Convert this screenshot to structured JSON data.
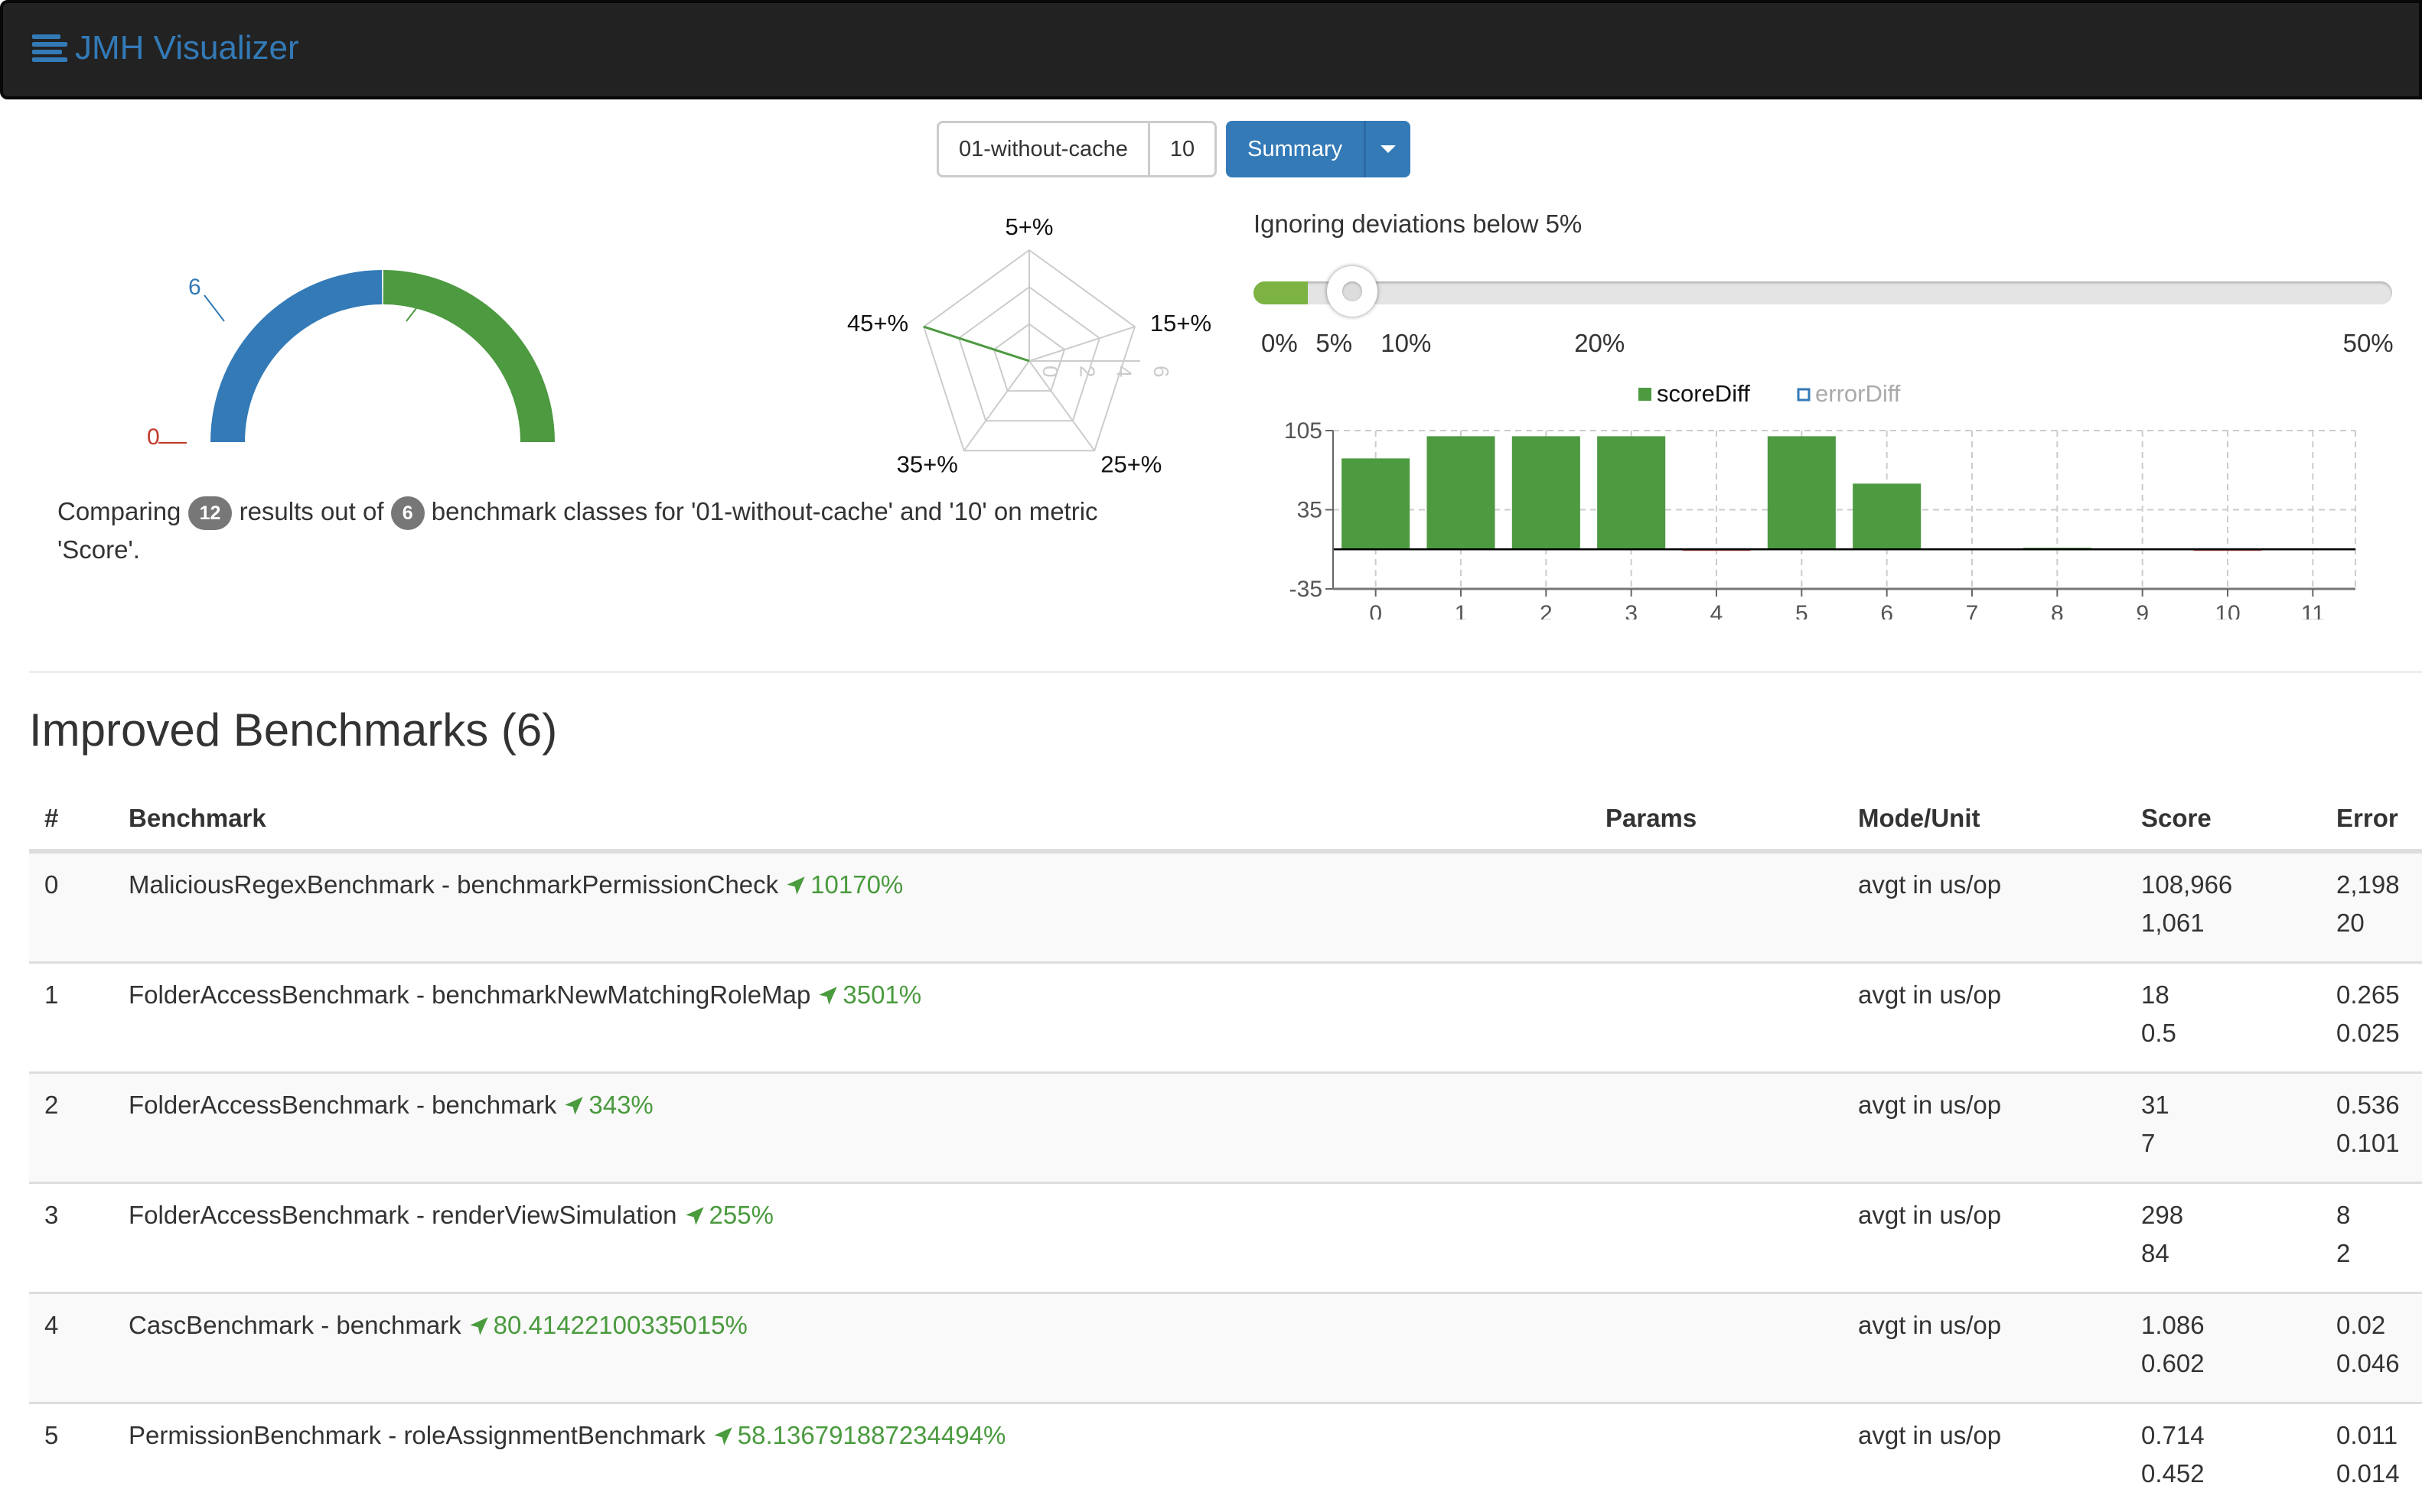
{
  "header": {
    "title": "JMH Visualizer",
    "icon": "list-icon"
  },
  "controls": {
    "run_a": "01-without-cache",
    "run_b": "10",
    "view_button": "Summary",
    "dropdown_icon": "caret-down-icon"
  },
  "gauge": {
    "left_value": "6",
    "right_value": "6",
    "zero_value": "0",
    "colors": {
      "worse": "#337ab7",
      "better": "#4d9a41",
      "zero": "#c0392b"
    }
  },
  "radar": {
    "axes": [
      "5+%",
      "15+%",
      "25+%",
      "35+%",
      "45+%"
    ],
    "values": [
      0,
      0,
      0,
      0,
      6
    ],
    "scale_ticks": [
      "0",
      "2",
      "4",
      "6"
    ],
    "max": 6
  },
  "description": {
    "prefix": "Comparing",
    "results_count": "12",
    "middle": "results out of",
    "classes_count": "6",
    "suffix": "benchmark classes for '01-without-cache' and '10' on metric 'Score'."
  },
  "slider": {
    "label": "Ignoring deviations below 5%",
    "value_percent": 5,
    "max_percent": 50,
    "ticks": [
      {
        "label": "0%",
        "value": 0
      },
      {
        "label": "5%",
        "value": 5
      },
      {
        "label": "10%",
        "value": 10
      },
      {
        "label": "20%",
        "value": 20
      },
      {
        "label": "50%",
        "value": 50
      }
    ]
  },
  "chart_data": {
    "type": "bar",
    "legend": [
      {
        "name": "scoreDiff",
        "color": "#4d9a41",
        "active": true
      },
      {
        "name": "errorDiff",
        "color": "#337ab7",
        "active": false
      }
    ],
    "legend_position": "top-center",
    "categories": [
      "0",
      "1",
      "2",
      "3",
      "4",
      "5",
      "6",
      "7",
      "8",
      "9",
      "10",
      "11"
    ],
    "series": [
      {
        "name": "scoreDiff",
        "values": [
          80.4,
          100,
          100,
          100,
          -1,
          100,
          58.1,
          0,
          1,
          0,
          -0.5,
          0
        ]
      }
    ],
    "yticks": [
      "105",
      "35",
      "-35"
    ],
    "ylim": [
      -35,
      105
    ],
    "grid": true,
    "positive_color": "#4d9a41",
    "negative_color": "#d9534f"
  },
  "improved": {
    "title": "Improved Benchmarks (6)",
    "columns": [
      "#",
      "Benchmark",
      "Params",
      "Mode/Unit",
      "Score",
      "Error"
    ],
    "rows": [
      {
        "idx": "0",
        "name": "MaliciousRegexBenchmark - benchmarkPermissionCheck",
        "pct": "10170%",
        "params": "",
        "mode": "avgt in us/op",
        "score1": "108,966",
        "score2": "1,061",
        "err1": "2,198",
        "err2": "20"
      },
      {
        "idx": "1",
        "name": "FolderAccessBenchmark - benchmarkNewMatchingRoleMap",
        "pct": "3501%",
        "params": "",
        "mode": "avgt in us/op",
        "score1": "18",
        "score2": "0.5",
        "err1": "0.265",
        "err2": "0.025"
      },
      {
        "idx": "2",
        "name": "FolderAccessBenchmark - benchmark",
        "pct": "343%",
        "params": "",
        "mode": "avgt in us/op",
        "score1": "31",
        "score2": "7",
        "err1": "0.536",
        "err2": "0.101"
      },
      {
        "idx": "3",
        "name": "FolderAccessBenchmark - renderViewSimulation",
        "pct": "255%",
        "params": "",
        "mode": "avgt in us/op",
        "score1": "298",
        "score2": "84",
        "err1": "8",
        "err2": "2"
      },
      {
        "idx": "4",
        "name": "CascBenchmark - benchmark",
        "pct": "80.41422100335015%",
        "params": "",
        "mode": "avgt in us/op",
        "score1": "1.086",
        "score2": "0.602",
        "err1": "0.02",
        "err2": "0.046"
      },
      {
        "idx": "5",
        "name": "PermissionBenchmark - roleAssignmentBenchmark",
        "pct": "58.136791887234494%",
        "params": "",
        "mode": "avgt in us/op",
        "score1": "0.714",
        "score2": "0.452",
        "err1": "0.011",
        "err2": "0.014"
      }
    ]
  }
}
